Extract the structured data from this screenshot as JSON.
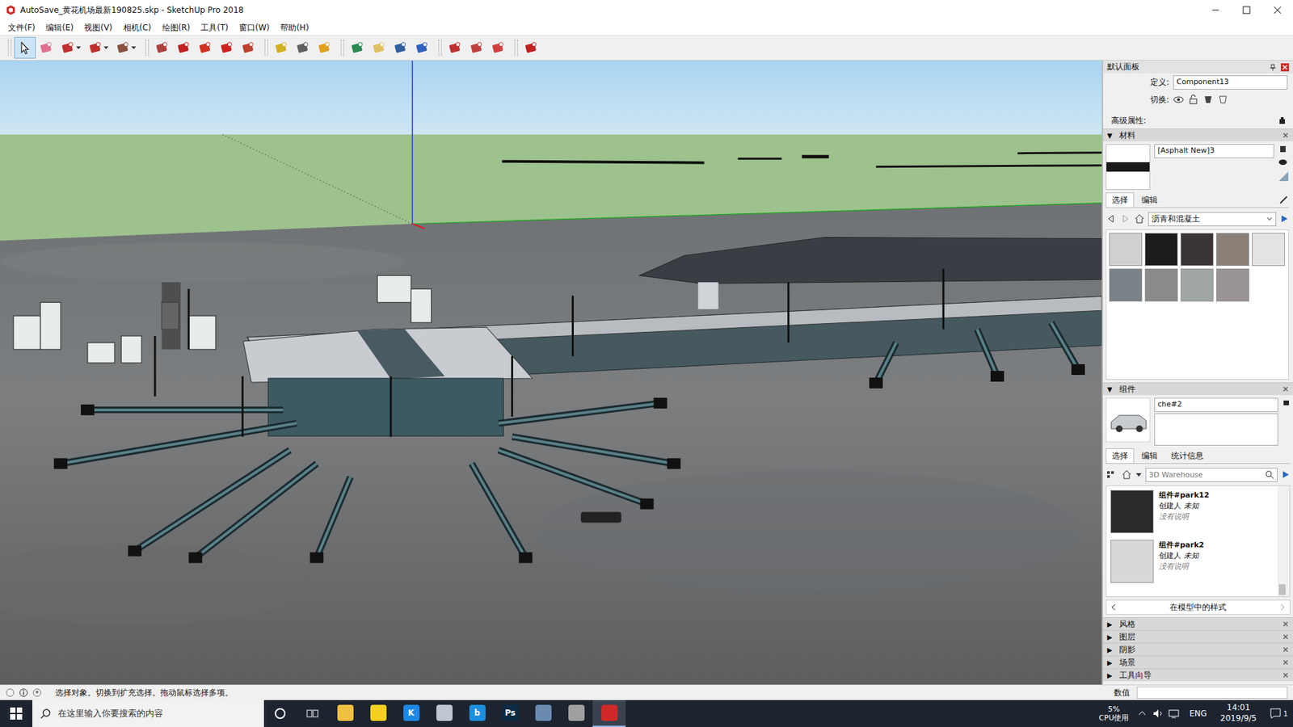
{
  "window": {
    "title": "AutoSave_黄花机场最新190825.skp - SketchUp Pro 2018"
  },
  "menu": [
    "文件(F)",
    "编辑(E)",
    "视图(V)",
    "相机(C)",
    "绘图(R)",
    "工具(T)",
    "窗口(W)",
    "帮助(H)"
  ],
  "toolbar": {
    "groups": [
      [
        {
          "selected": true,
          "menu": false
        },
        {
          "selected": false,
          "menu": false
        },
        {
          "selected": false,
          "menu": true
        },
        {
          "selected": false,
          "menu": true
        },
        {
          "selected": false,
          "menu": true
        }
      ],
      [
        {
          "selected": false,
          "menu": false
        },
        {
          "selected": false,
          "menu": false
        },
        {
          "selected": false,
          "menu": false
        },
        {
          "selected": false,
          "menu": false
        },
        {
          "selected": false,
          "menu": false
        }
      ],
      [
        {
          "selected": false,
          "menu": false
        },
        {
          "selected": false,
          "menu": false
        },
        {
          "selected": false,
          "menu": false
        }
      ],
      [
        {
          "selected": false,
          "menu": false
        },
        {
          "selected": false,
          "menu": false
        },
        {
          "selected": false,
          "menu": false
        },
        {
          "selected": false,
          "menu": false
        }
      ],
      [
        {
          "selected": false,
          "menu": false
        },
        {
          "selected": false,
          "menu": false
        },
        {
          "selected": false,
          "menu": false
        }
      ],
      [
        {
          "selected": false,
          "menu": false
        }
      ]
    ]
  },
  "tray_panel": {
    "title": "默认面板",
    "definition_label": "定义:",
    "definition_value": "Component13",
    "toggle_label": "切换:",
    "advanced_label": "高级属性:",
    "materials": {
      "toggle": "▼",
      "title": "材料",
      "expanded": true,
      "name": "[Asphalt New]3",
      "tabs": [
        {
          "label": "选择",
          "selected": true
        },
        {
          "label": "编辑",
          "selected": false
        }
      ],
      "library": "沥青和混凝土",
      "swatches": [
        {
          "color": "#cfd0d0"
        },
        {
          "color": "#1c1c1c"
        },
        {
          "color": "#3a3436"
        },
        {
          "color": "#8a8078"
        },
        {
          "color": "#e4e4e4"
        },
        {
          "color": "#7a8288"
        },
        {
          "color": "#898b8b"
        },
        {
          "color": "#a0a6a4"
        },
        {
          "color": "#9a9393"
        }
      ]
    },
    "components": {
      "toggle": "▼",
      "title": "组件",
      "expanded": true,
      "name": "che#2",
      "tabs": [
        {
          "label": "选择",
          "selected": true
        },
        {
          "label": "编辑",
          "selected": false
        },
        {
          "label": "统计信息",
          "selected": false
        }
      ],
      "search_placeholder": "3D Warehouse",
      "items": [
        {
          "name": "组件#park12",
          "creator_label": "创建人",
          "creator": "未知",
          "description": "没有说明",
          "color": "#2a2a2a"
        },
        {
          "name": "组件#park2",
          "creator_label": "创建人",
          "creator": "未知",
          "description": "没有说明",
          "color": "#d8d8d8"
        }
      ],
      "footer": "在模型中的样式"
    },
    "collapsed": [
      {
        "toggle": "▶",
        "title": "风格",
        "expanded": false
      },
      {
        "toggle": "▶",
        "title": "图层",
        "expanded": false
      },
      {
        "toggle": "▶",
        "title": "阴影",
        "expanded": false
      },
      {
        "toggle": "▶",
        "title": "场景",
        "expanded": false
      },
      {
        "toggle": "▶",
        "title": "工具向导",
        "expanded": false
      }
    ]
  },
  "status_bar": {
    "message": "选择对象。切换到扩充选择。拖动鼠标选择多项。",
    "measure_label": "数值"
  },
  "taskbar": {
    "search_placeholder": "在这里输入你要搜索的内容",
    "apps": [
      {
        "color": "#f0c040",
        "selected": false
      },
      {
        "color": "#f5d020",
        "selected": false
      },
      {
        "color": "#1e88e5",
        "label": "K",
        "selected": false
      },
      {
        "color": "#bfc8d0",
        "selected": false
      },
      {
        "color": "#1a8fe0",
        "label": "b",
        "selected": false
      },
      {
        "color": "#0b2a44",
        "label": "Ps",
        "selected": false
      },
      {
        "color": "#6a8ab0",
        "selected": false
      },
      {
        "color": "#a0a0a0",
        "selected": false
      },
      {
        "color": "#d02828",
        "selected": true
      }
    ],
    "cpu_value": "5%",
    "cpu_label": "CPU使用",
    "language": "ENG",
    "time": "14:01",
    "date": "2019/9/5",
    "notifications": "1"
  }
}
